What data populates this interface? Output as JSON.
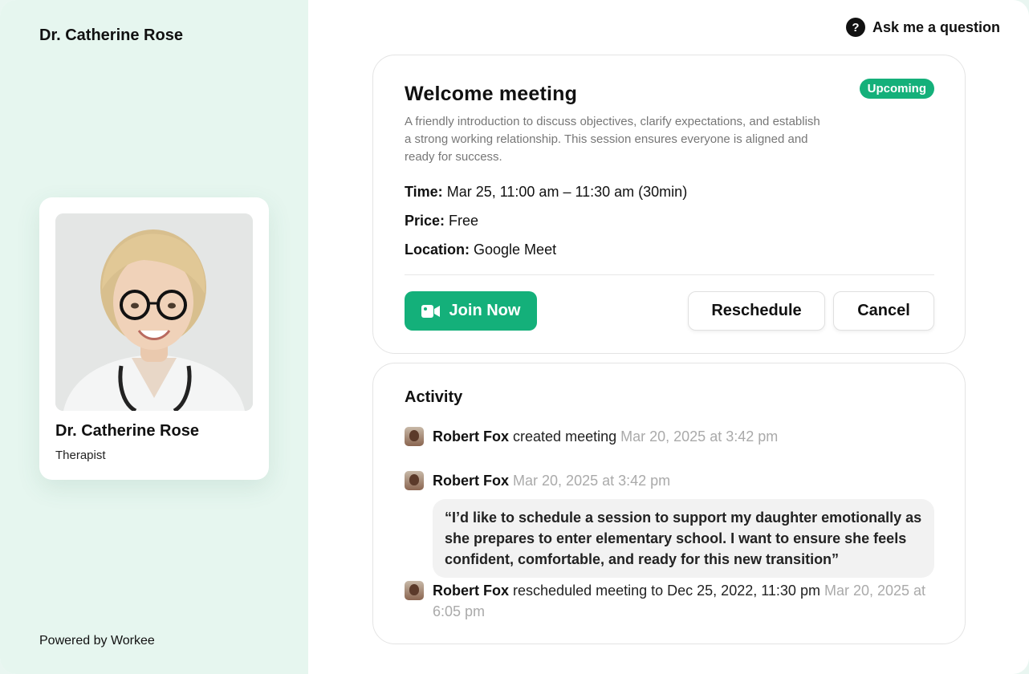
{
  "sidebar": {
    "brand": "Dr. Catherine Rose",
    "profile": {
      "name": "Dr. Catherine Rose",
      "role": "Therapist"
    },
    "powered_by": "Powered by Workee"
  },
  "header": {
    "help_icon": "question-icon",
    "ask_label": "Ask me a question"
  },
  "meeting": {
    "title": "Welcome meeting",
    "status": "Upcoming",
    "status_color": "#14b07a",
    "description": "A friendly introduction to discuss objectives, clarify expectations, and establish a strong working relationship. This session ensures everyone is aligned and ready for success.",
    "time_label": "Time:",
    "time_value": "Mar 25, 11:00 am – 11:30 am (30min)",
    "price_label": "Price:",
    "price_value": "Free",
    "location_label": "Location:",
    "location_value": "Google Meet",
    "join_label": "Join Now",
    "join_icon": "video-camera-icon",
    "reschedule_label": "Reschedule",
    "cancel_label": "Cancel"
  },
  "activity": {
    "title": "Activity",
    "entries": [
      {
        "user": "Robert Fox",
        "action": "created meeting",
        "timestamp": "Mar 20, 2025 at 3:42 pm"
      },
      {
        "user": "Robert Fox",
        "action": "",
        "timestamp": "Mar 20, 2025 at 3:42 pm",
        "comment": "“I’d like to schedule a session to support my daughter emotionally as she prepares to enter elementary school. I want to ensure she feels confident, comfortable, and ready for this new transition”"
      },
      {
        "user": "Robert Fox",
        "action": "rescheduled meeting to Dec 25, 2022, 11:30 pm",
        "timestamp": "Mar 20, 2025 at 6:05 pm"
      }
    ]
  },
  "colors": {
    "accent": "#14b07a",
    "sidebar_bg": "#e6f6ef"
  }
}
